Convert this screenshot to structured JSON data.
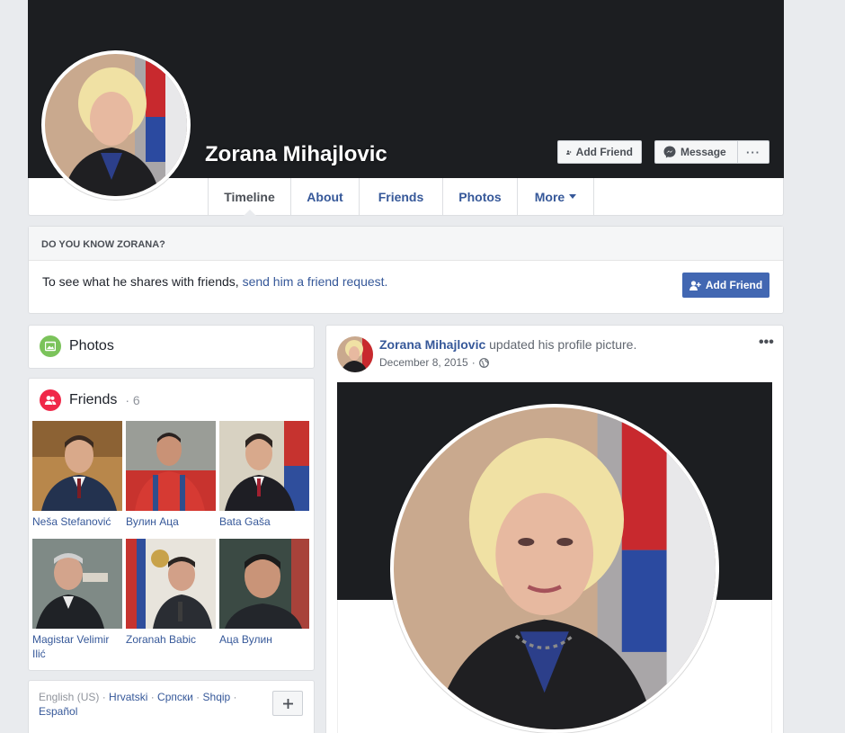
{
  "profile": {
    "name": "Zorana Mihajlovic"
  },
  "header_actions": {
    "add_friend": "Add Friend",
    "message": "Message",
    "more": "···"
  },
  "tabs": [
    {
      "label": "Timeline"
    },
    {
      "label": "About"
    },
    {
      "label": "Friends"
    },
    {
      "label": "Photos"
    },
    {
      "label": "More"
    }
  ],
  "know_box": {
    "heading": "DO YOU KNOW ZORANA?",
    "text": "To see what he shares with friends, ",
    "link": "send him a friend request.",
    "button": "Add Friend"
  },
  "photos_card": {
    "title": "Photos"
  },
  "friends_card": {
    "title": "Friends",
    "count": " · 6",
    "friends": [
      {
        "name": "Neša Stefanović"
      },
      {
        "name": "Вулин Аца"
      },
      {
        "name": "Bata Gaša"
      },
      {
        "name": "Magistar Velimir Ilić"
      },
      {
        "name": "Zoranah Babic"
      },
      {
        "name": "Аца Вулин"
      }
    ]
  },
  "languages": {
    "current": "English (US)",
    "others": [
      "Hrvatski",
      "Српски",
      "Shqip",
      "Español"
    ],
    "separator": " · "
  },
  "post": {
    "author": "Zorana Mihajlovic",
    "action": " updated his profile picture.",
    "date": "December 8, 2015",
    "date_sep": " · ",
    "menu": "•••"
  },
  "colors": {
    "link": "#365899",
    "primary_button": "#4267b2",
    "cover": "#1c1e21",
    "page_bg": "#e9ebee"
  }
}
